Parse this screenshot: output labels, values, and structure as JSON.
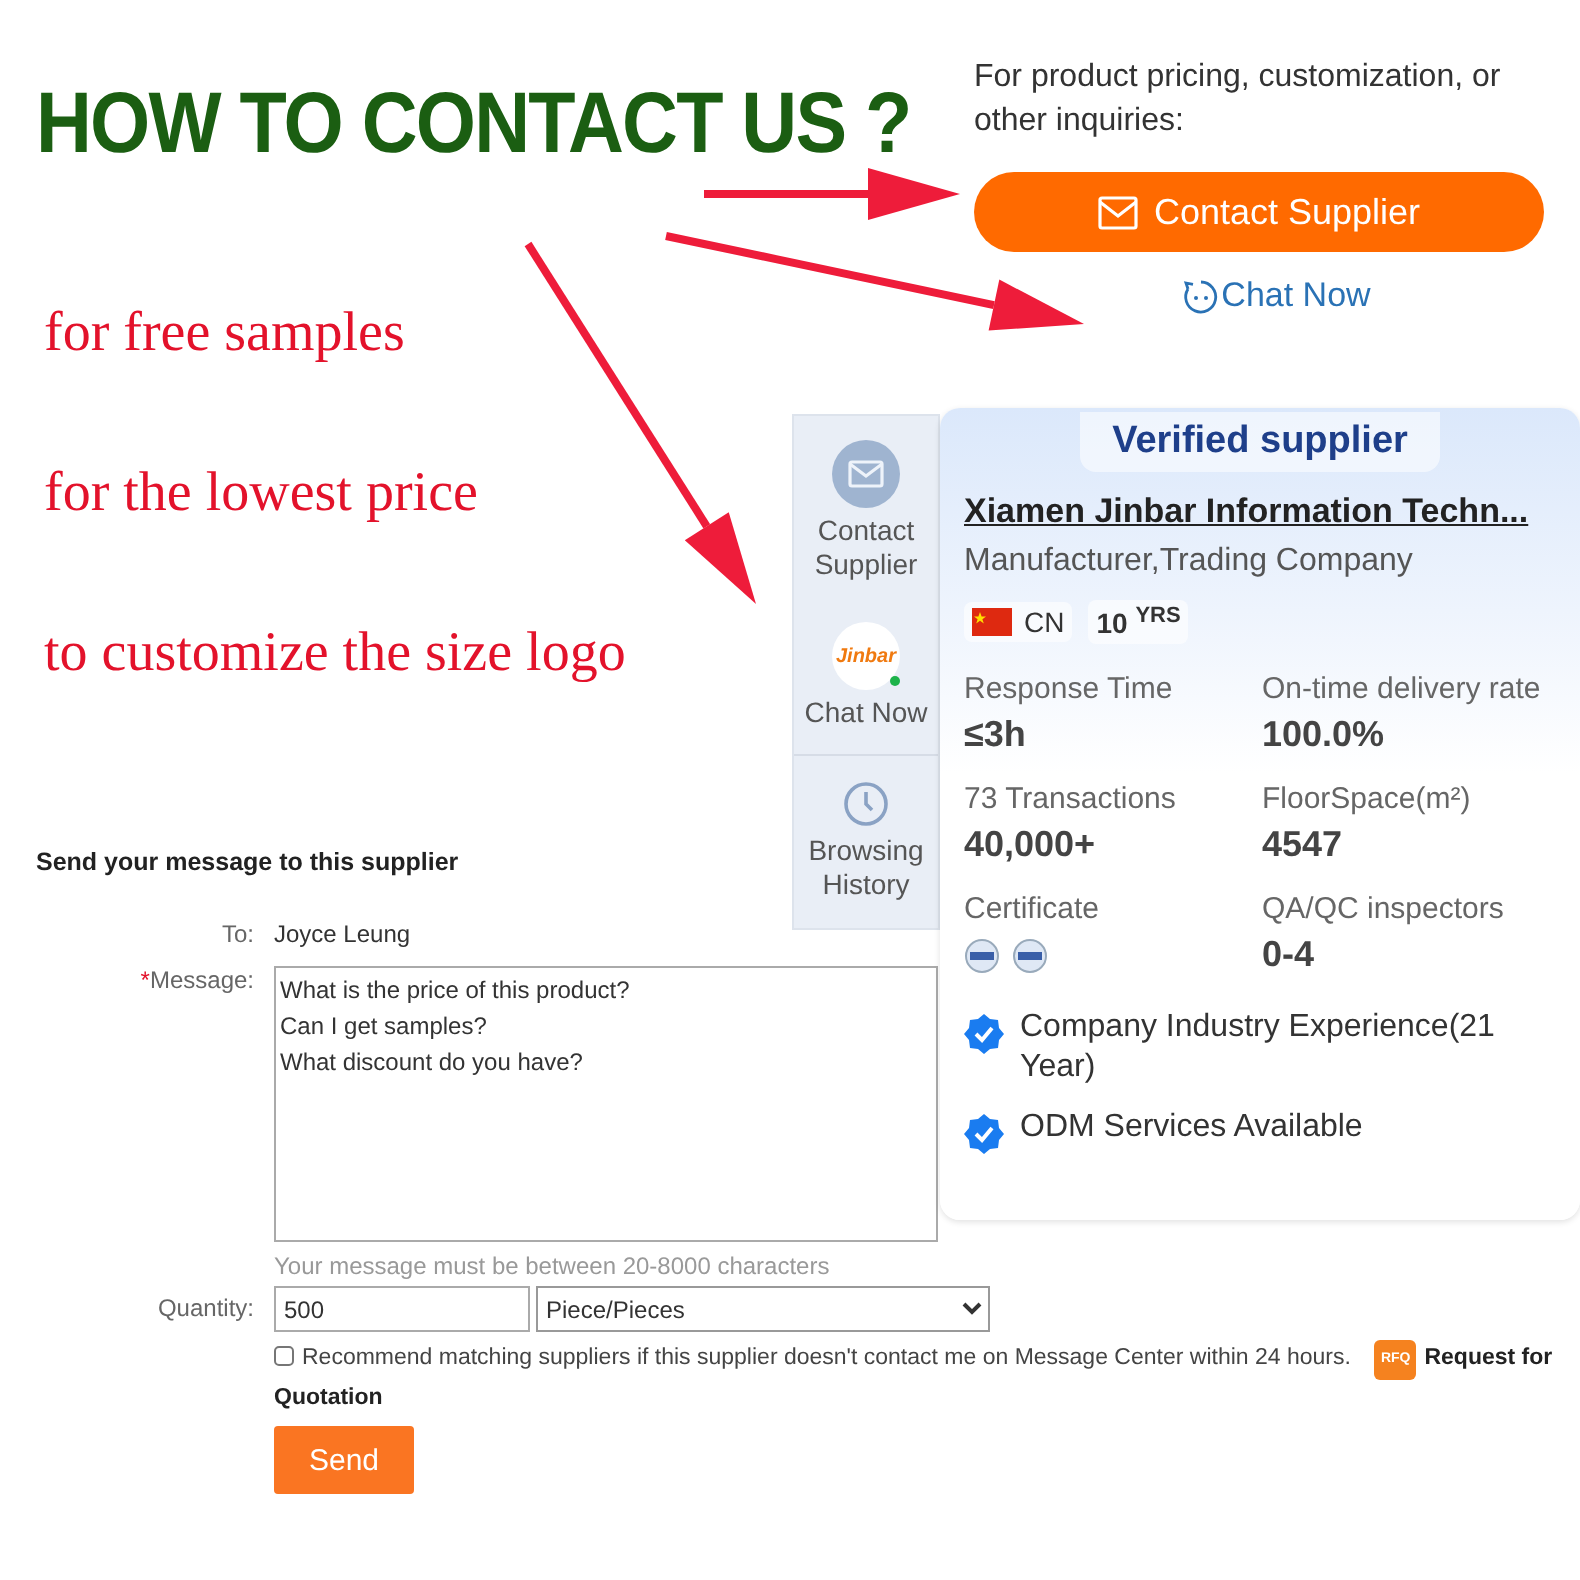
{
  "heading": "HOW TO CONTACT US ?",
  "reasons": [
    "for free samples",
    "for the lowest price",
    "to customize the size logo"
  ],
  "contact_box": {
    "intro": "For product pricing, customization, or other inquiries:",
    "contact_button": "Contact Supplier",
    "chat_link": "Chat Now"
  },
  "sidebar": {
    "items": [
      {
        "kind": "mail",
        "label": "Contact Supplier"
      },
      {
        "kind": "avatar",
        "label": "Chat Now",
        "logo_text": "Jinbar",
        "online": true
      },
      {
        "kind": "history",
        "label": "Browsing History"
      }
    ]
  },
  "supplier_card": {
    "badge": "Verified supplier",
    "name": "Xiamen Jinbar Information Techn...",
    "business_type": "Manufacturer,Trading Company",
    "country": "CN",
    "years": "10",
    "years_unit": "YRS",
    "stats": [
      {
        "kind": "value",
        "label": "Response Time",
        "value": "≤3h"
      },
      {
        "kind": "value",
        "label": "On-time delivery rate",
        "value": "100.0%"
      },
      {
        "kind": "value",
        "label": "73 Transactions",
        "value": "40,000+"
      },
      {
        "kind": "value",
        "label": "FloorSpace(m²)",
        "value": "4547"
      },
      {
        "kind": "certificates",
        "label": "Certificate"
      },
      {
        "kind": "value",
        "label": "QA/QC inspectors",
        "value": "0-4"
      }
    ],
    "features": [
      "Company Industry Experience(21 Year)",
      "ODM Services Available"
    ]
  },
  "message_form": {
    "title": "Send your message to this supplier",
    "to_label": "To:",
    "to_value": "Joyce Leung",
    "required_mark": "*",
    "message_label": "Message:",
    "message": "What is the price of this product?\nCan I get samples?\nWhat discount do you have?",
    "hint": "Your message must be between 20-8000 characters",
    "quantity_label": "Quantity:",
    "quantity": "500",
    "unit": "Piece/Pieces",
    "recommend_checked": false,
    "recommend_text": "Recommend matching suppliers if this supplier doesn't contact me on Message Center within 24 hours.",
    "rfq_badge": "RFQ",
    "rfq_link_lines": [
      "Request for",
      "Quotation"
    ],
    "send": "Send"
  }
}
